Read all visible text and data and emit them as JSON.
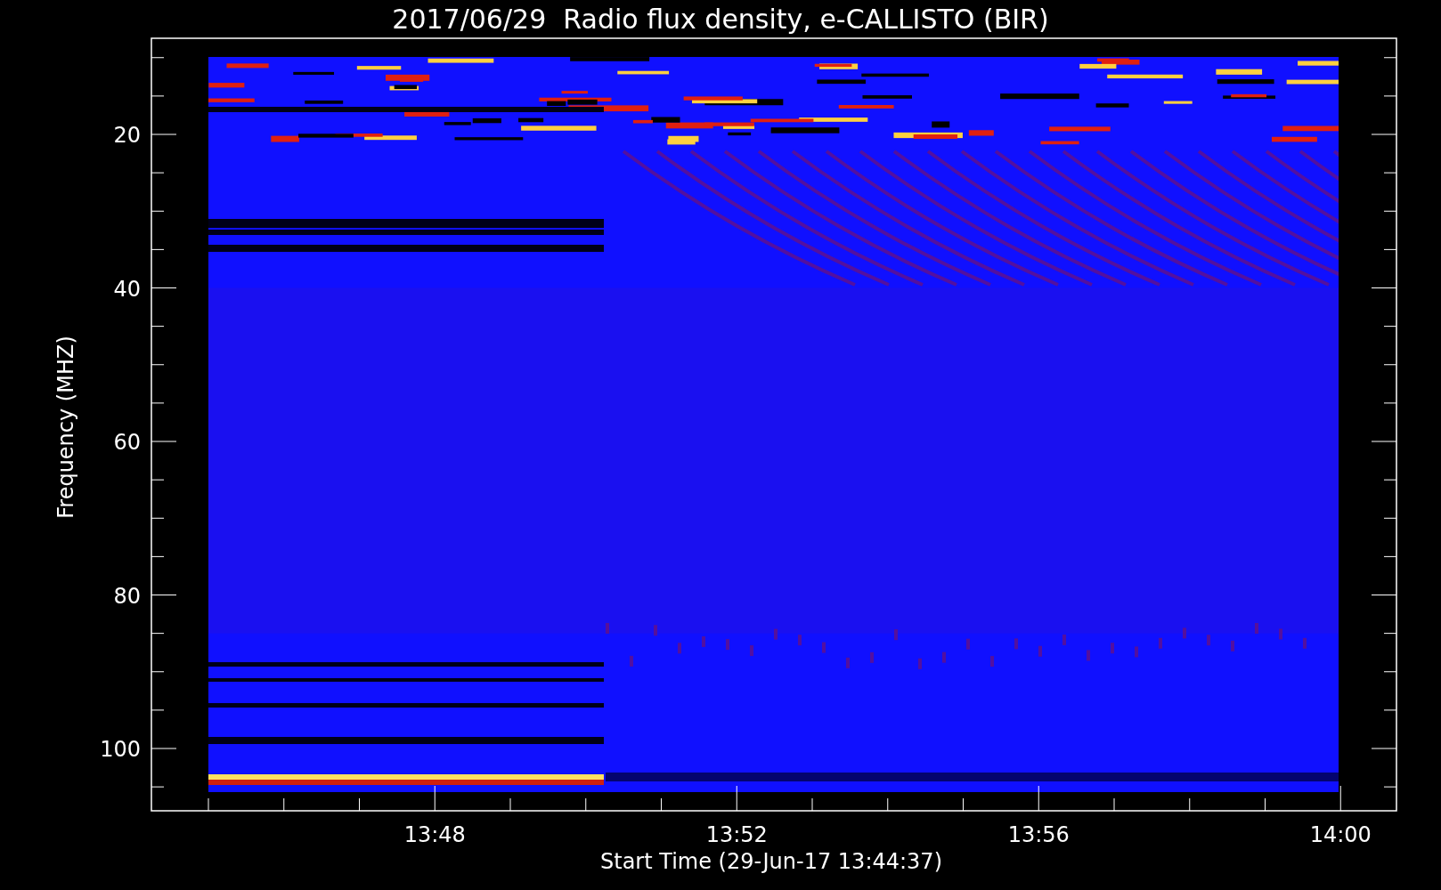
{
  "title": "2017/06/29  Radio flux density, e-CALLISTO (BIR)",
  "y_axis": {
    "label": "Frequency (MHZ)",
    "ticks": [
      "20",
      "40",
      "60",
      "80",
      "100"
    ]
  },
  "x_axis": {
    "label": "Start Time (29-Jun-17 13:44:37)",
    "ticks": [
      "13:48",
      "13:52",
      "13:56",
      "14:00"
    ]
  }
}
